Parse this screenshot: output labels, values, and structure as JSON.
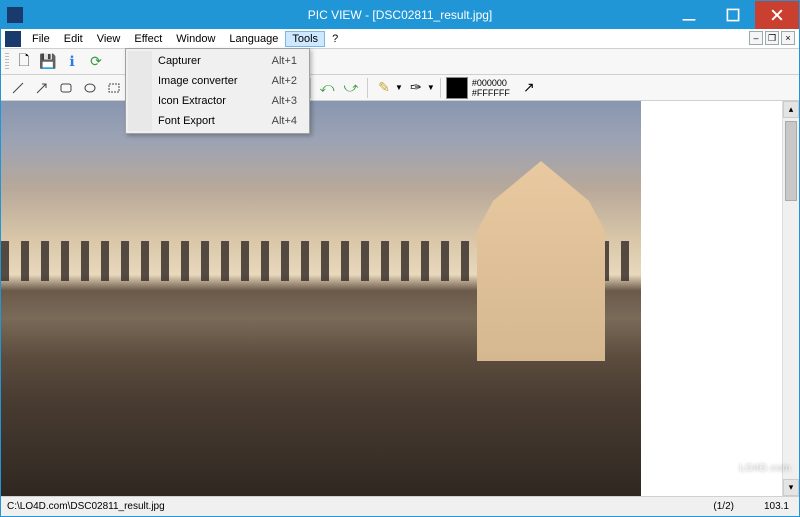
{
  "title": "PIC VIEW  - [DSC02811_result.jpg]",
  "menus": {
    "file": "File",
    "edit": "Edit",
    "view": "View",
    "effect": "Effect",
    "window": "Window",
    "language": "Language",
    "tools": "Tools",
    "help": "?"
  },
  "tools_menu": [
    {
      "label": "Capturer",
      "shortcut": "Alt+1"
    },
    {
      "label": "Image converter",
      "shortcut": "Alt+2"
    },
    {
      "label": "Icon Extractor",
      "shortcut": "Alt+3"
    },
    {
      "label": "Font Export",
      "shortcut": "Alt+4"
    }
  ],
  "colors": {
    "fg": "#000000",
    "bg": "#FFFFFF"
  },
  "status": {
    "path": "C:\\LO4D.com\\DSC02811_result.jpg",
    "page": "(1/2)",
    "zoom": "103.1"
  },
  "watermark": "LO4D.com"
}
